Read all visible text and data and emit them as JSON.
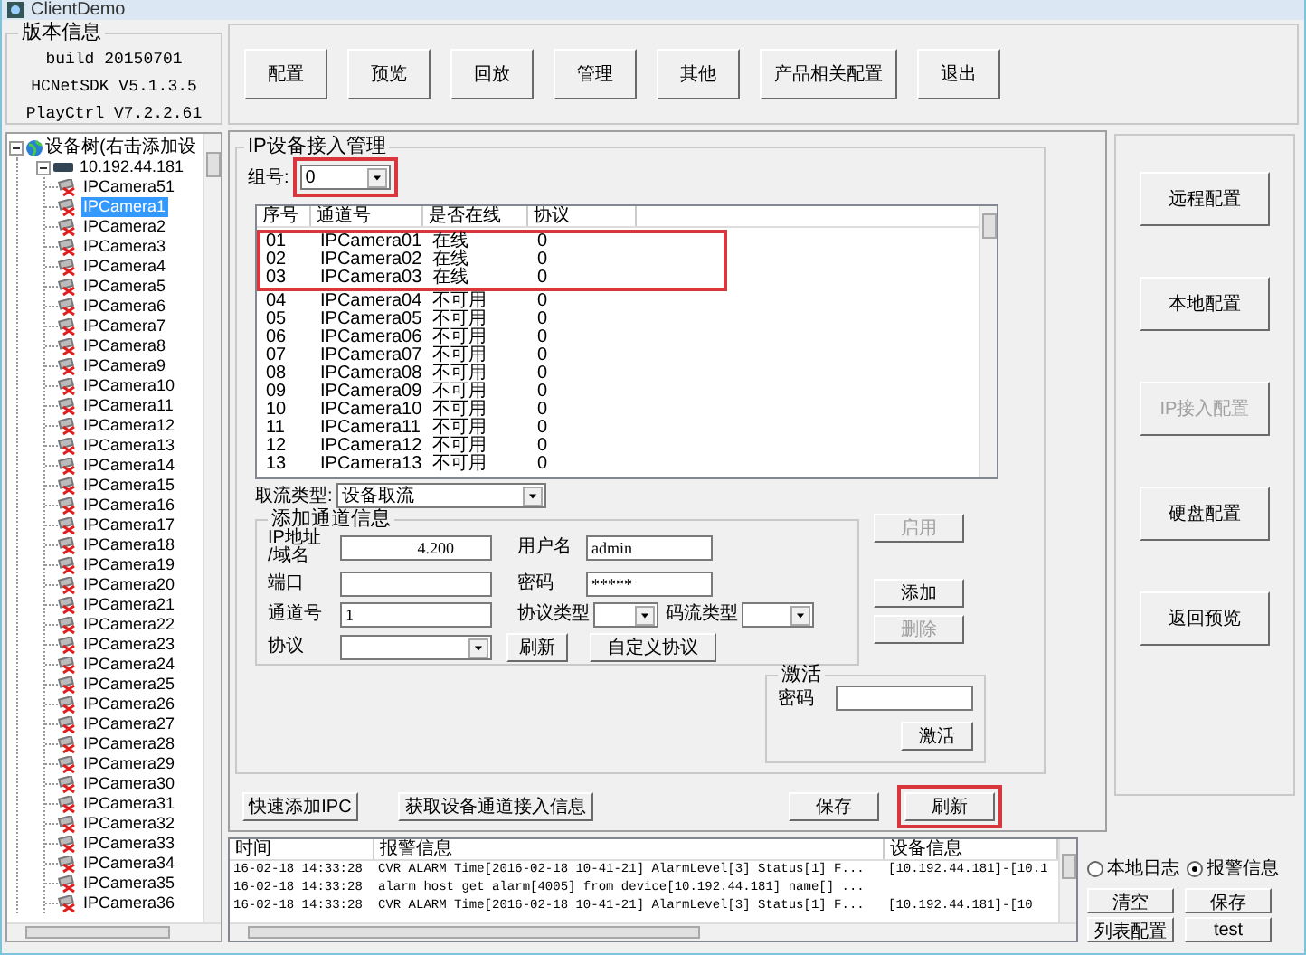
{
  "window": {
    "title": "ClientDemo"
  },
  "version_info": {
    "title": "版本信息",
    "lines": [
      "build 20150701",
      "HCNetSDK V5.1.3.5",
      "PlayCtrl V7.2.2.61"
    ]
  },
  "device_tree": {
    "label": "设备树(右击添加设",
    "expanded": true,
    "children": [
      {
        "label": "10.192.44.181",
        "expanded": true,
        "children": [
          {
            "label": "IPCamera51",
            "selected": false
          },
          {
            "label": "IPCamera1",
            "selected": true
          },
          {
            "label": "IPCamera2",
            "selected": false
          },
          {
            "label": "IPCamera3",
            "selected": false
          },
          {
            "label": "IPCamera4",
            "selected": false
          },
          {
            "label": "IPCamera5",
            "selected": false
          },
          {
            "label": "IPCamera6",
            "selected": false
          },
          {
            "label": "IPCamera7",
            "selected": false
          },
          {
            "label": "IPCamera8",
            "selected": false
          },
          {
            "label": "IPCamera9",
            "selected": false
          },
          {
            "label": "IPCamera10",
            "selected": false
          },
          {
            "label": "IPCamera11",
            "selected": false
          },
          {
            "label": "IPCamera12",
            "selected": false
          },
          {
            "label": "IPCamera13",
            "selected": false
          },
          {
            "label": "IPCamera14",
            "selected": false
          },
          {
            "label": "IPCamera15",
            "selected": false
          },
          {
            "label": "IPCamera16",
            "selected": false
          },
          {
            "label": "IPCamera17",
            "selected": false
          },
          {
            "label": "IPCamera18",
            "selected": false
          },
          {
            "label": "IPCamera19",
            "selected": false
          },
          {
            "label": "IPCamera20",
            "selected": false
          },
          {
            "label": "IPCamera21",
            "selected": false
          },
          {
            "label": "IPCamera22",
            "selected": false
          },
          {
            "label": "IPCamera23",
            "selected": false
          },
          {
            "label": "IPCamera24",
            "selected": false
          },
          {
            "label": "IPCamera25",
            "selected": false
          },
          {
            "label": "IPCamera26",
            "selected": false
          },
          {
            "label": "IPCamera27",
            "selected": false
          },
          {
            "label": "IPCamera28",
            "selected": false
          },
          {
            "label": "IPCamera29",
            "selected": false
          },
          {
            "label": "IPCamera30",
            "selected": false
          },
          {
            "label": "IPCamera31",
            "selected": false
          },
          {
            "label": "IPCamera32",
            "selected": false
          },
          {
            "label": "IPCamera33",
            "selected": false
          },
          {
            "label": "IPCamera34",
            "selected": false
          },
          {
            "label": "IPCamera35",
            "selected": false
          },
          {
            "label": "IPCamera36",
            "selected": false
          }
        ]
      }
    ]
  },
  "toolbar": [
    "配置",
    "预览",
    "回放",
    "管理",
    "其他",
    "产品相关配置",
    "退出"
  ],
  "ip_access": {
    "title": "IP设备接入管理",
    "group": {
      "label": "组号:",
      "value": "0",
      "annotated": true
    },
    "columns": [
      "序号",
      "通道号",
      "是否在线",
      "协议"
    ],
    "rows": [
      {
        "cells": [
          "01",
          "IPCamera01",
          "在线",
          "0"
        ],
        "annotated": true
      },
      {
        "cells": [
          "02",
          "IPCamera02",
          "在线",
          "0"
        ],
        "annotated": true
      },
      {
        "cells": [
          "03",
          "IPCamera03",
          "在线",
          "0"
        ],
        "annotated": true
      },
      {
        "cells": [
          "04",
          "IPCamera04",
          "不可用",
          "0"
        ],
        "annotated": false
      },
      {
        "cells": [
          "05",
          "IPCamera05",
          "不可用",
          "0"
        ],
        "annotated": false
      },
      {
        "cells": [
          "06",
          "IPCamera06",
          "不可用",
          "0"
        ],
        "annotated": false
      },
      {
        "cells": [
          "07",
          "IPCamera07",
          "不可用",
          "0"
        ],
        "annotated": false
      },
      {
        "cells": [
          "08",
          "IPCamera08",
          "不可用",
          "0"
        ],
        "annotated": false
      },
      {
        "cells": [
          "09",
          "IPCamera09",
          "不可用",
          "0"
        ],
        "annotated": false
      },
      {
        "cells": [
          "10",
          "IPCamera10",
          "不可用",
          "0"
        ],
        "annotated": false
      },
      {
        "cells": [
          "11",
          "IPCamera11",
          "不可用",
          "0"
        ],
        "annotated": false
      },
      {
        "cells": [
          "12",
          "IPCamera12",
          "不可用",
          "0"
        ],
        "annotated": false
      },
      {
        "cells": [
          "13",
          "IPCamera13",
          "不可用",
          "0"
        ],
        "annotated": false
      }
    ],
    "stream_type": {
      "label": "取流类型:",
      "value": "设备取流"
    },
    "add_channel": {
      "title": "添加通道信息",
      "ip": {
        "label": "IP地址",
        "label_2": "/域名",
        "value": "4.200"
      },
      "port": {
        "label": "端口"
      },
      "channel": {
        "label": "通道号",
        "value": "1"
      },
      "protocol": {
        "label": "协议"
      },
      "refresh": "刷新",
      "custom_protocol": "自定义协议",
      "user": {
        "label": "用户名",
        "value": "admin"
      },
      "password": {
        "label": "密码",
        "value": "*****"
      },
      "protocol_type": {
        "label": "协议类型"
      },
      "stream_type": {
        "label": "码流类型"
      }
    },
    "side_buttons": [
      {
        "label": "启用",
        "disabled": true
      },
      {
        "label": "添加",
        "disabled": false
      },
      {
        "label": "删除",
        "disabled": true
      }
    ],
    "activate": {
      "title": "激活",
      "password_label": "密码",
      "button": "激活"
    }
  },
  "bottom_buttons": [
    {
      "label": "快速添加IPC",
      "annotated": false
    },
    {
      "label": "获取设备通道接入信息",
      "annotated": false
    },
    {
      "label": "保存",
      "annotated": false
    },
    {
      "label": "刷新",
      "annotated": true
    }
  ],
  "config_buttons": [
    {
      "label": "远程配置",
      "disabled": false
    },
    {
      "label": "本地配置",
      "disabled": false
    },
    {
      "label": "IP接入配置",
      "disabled": true
    },
    {
      "label": "硬盘配置",
      "disabled": false
    },
    {
      "label": "返回预览",
      "disabled": false
    }
  ],
  "alarm_log": {
    "columns": [
      "时间",
      "报警信息",
      "设备信息"
    ],
    "rows": [
      [
        "16-02-18 14:33:28",
        "CVR ALARM Time[2016-02-18 10-41-21] AlarmLevel[3] Status[1] F...",
        "[10.192.44.181]-[10.1"
      ],
      [
        "16-02-18 14:33:28",
        "alarm host get alarm[4005] from device[10.192.44.181] name[] ...",
        ""
      ],
      [
        "16-02-18 14:33:28",
        "CVR ALARM Time[2016-02-18 10-41-21] AlarmLevel[3] Status[1] F...",
        "[10.192.44.181]-[10"
      ]
    ]
  },
  "log_mode": [
    {
      "label": "本地日志",
      "selected": false
    },
    {
      "label": "报警信息",
      "selected": true
    }
  ],
  "log_buttons": [
    "清空",
    "保存",
    "列表配置",
    "test"
  ]
}
